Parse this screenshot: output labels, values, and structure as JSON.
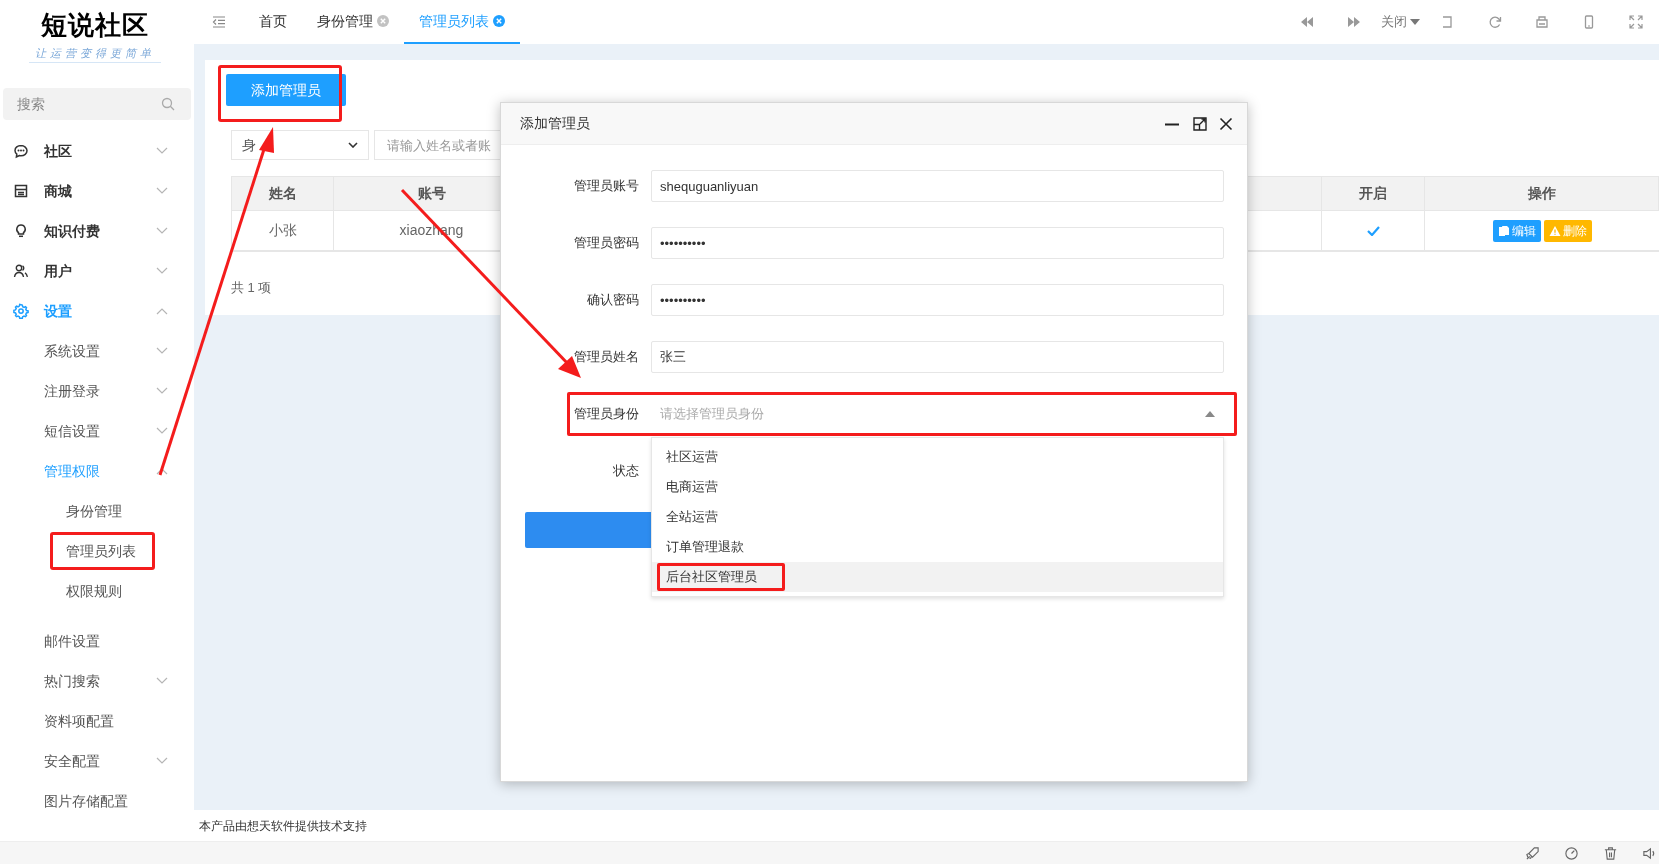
{
  "logo": {
    "name": "短说社区",
    "slogan": "让运营变得更简单"
  },
  "search": {
    "placeholder": "搜索"
  },
  "sidebar": {
    "items": [
      {
        "label": "社区",
        "selected": false,
        "expanded": false
      },
      {
        "label": "商城",
        "selected": false,
        "expanded": false
      },
      {
        "label": "知识付费",
        "selected": false,
        "expanded": false
      },
      {
        "label": "用户",
        "selected": false,
        "expanded": false
      },
      {
        "label": "设置",
        "selected": true,
        "expanded": true,
        "children": [
          {
            "label": "系统设置",
            "selected": false,
            "expanded": false
          },
          {
            "label": "注册登录",
            "selected": false,
            "expanded": false
          },
          {
            "label": "短信设置",
            "selected": false,
            "expanded": false
          },
          {
            "label": "管理权限",
            "selected": true,
            "expanded": true,
            "children": [
              {
                "label": "身份管理",
                "selected": false,
                "annotated": false
              },
              {
                "label": "管理员列表",
                "selected": false,
                "annotated": true
              },
              {
                "label": "权限规则",
                "selected": false,
                "annotated": false
              }
            ]
          },
          {
            "label": "邮件设置",
            "selected": false
          },
          {
            "label": "热门搜索",
            "selected": false,
            "expanded": false
          },
          {
            "label": "资料项配置",
            "selected": false
          },
          {
            "label": "安全配置",
            "selected": false,
            "expanded": false
          },
          {
            "label": "图片存储配置",
            "selected": false
          }
        ]
      }
    ]
  },
  "tabs": [
    {
      "label": "首页",
      "closable": false,
      "selected": false
    },
    {
      "label": "身份管理",
      "closable": true,
      "selected": false
    },
    {
      "label": "管理员列表",
      "closable": true,
      "selected": true
    }
  ],
  "toolbar": {
    "close_menu": "关闭"
  },
  "page": {
    "add_button": {
      "label": "添加管理员",
      "annotated": true
    },
    "filter": {
      "select": "身",
      "placeholder": "请输入姓名或者账"
    },
    "table": {
      "columns": [
        "姓名",
        "账号",
        "开启",
        "操作"
      ],
      "rows": [
        {
          "cells": [
            "小张",
            "xiaozhang"
          ],
          "enabled": true,
          "actions": [
            "编辑",
            "删除"
          ]
        }
      ]
    },
    "total": "共 1 项"
  },
  "dialog": {
    "title": "添加管理员",
    "fields": [
      {
        "kind": "text",
        "label": "管理员账号",
        "value": "shequguanliyuan"
      },
      {
        "kind": "text",
        "label": "管理员密码",
        "value": "••••••••••"
      },
      {
        "kind": "text",
        "label": "确认密码",
        "value": "••••••••••"
      },
      {
        "kind": "text",
        "label": "管理员姓名",
        "value": "张三"
      },
      {
        "kind": "select",
        "label": "管理员身份",
        "placeholder": "请选择管理员身份",
        "expanded": true,
        "annotated": true,
        "options": [
          {
            "label": "社区运营",
            "selected": false,
            "annotated": false
          },
          {
            "label": "电商运营",
            "selected": false,
            "annotated": false
          },
          {
            "label": "全站运营",
            "selected": false,
            "annotated": false
          },
          {
            "label": "订单管理退款",
            "selected": false,
            "annotated": false
          },
          {
            "label": "后台社区管理员",
            "selected": true,
            "annotated": true
          }
        ]
      },
      {
        "kind": "status",
        "label": "状态"
      }
    ]
  },
  "footer": "本产品由想天软件提供技术支持"
}
